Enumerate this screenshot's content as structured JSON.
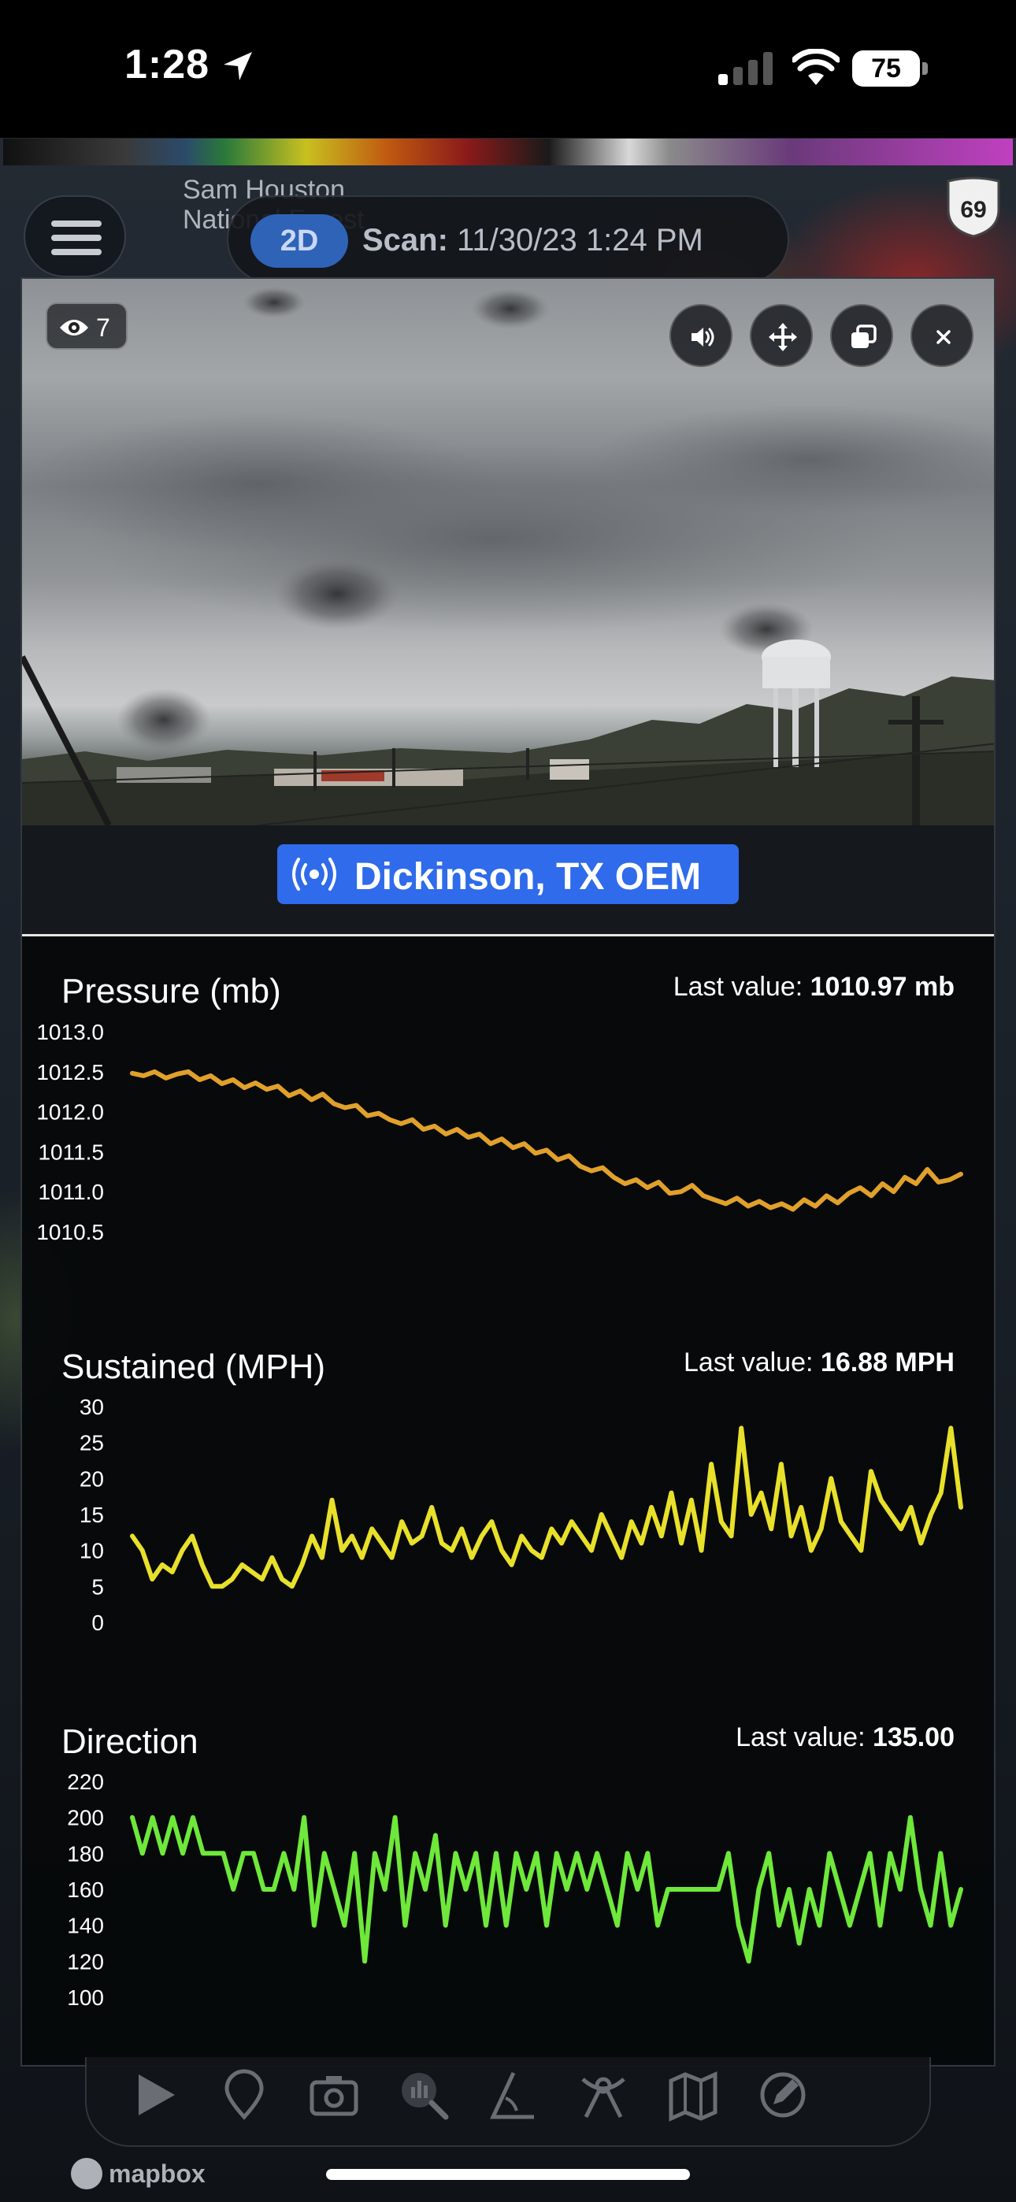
{
  "status_bar": {
    "time": "1:28",
    "battery": "75"
  },
  "map": {
    "label_line1": "Sam Houston",
    "label_line2": "National Forest",
    "route_number": "69"
  },
  "scan": {
    "mode": "2D",
    "label": "Scan:",
    "datetime": "11/30/23 1:24 PM"
  },
  "camera": {
    "viewer_count": "7"
  },
  "station": {
    "name": "Dickinson, TX OEM"
  },
  "charts": {
    "pressure": {
      "title": "Pressure (mb)",
      "last_label": "Last value:",
      "last_value": "1010.97 mb"
    },
    "sustained": {
      "title": "Sustained (MPH)",
      "last_label": "Last value:",
      "last_value": "16.88 MPH"
    },
    "direction": {
      "title": "Direction",
      "last_label": "Last value:",
      "last_value": "135.00"
    }
  },
  "chart_data": [
    {
      "type": "line",
      "title": "Pressure (mb)",
      "ylabel": "",
      "yticks": [
        "1013.0",
        "1012.5",
        "1012.0",
        "1011.5",
        "1011.0",
        "1010.5"
      ],
      "ylim": [
        1010.5,
        1013.0
      ],
      "color": "#e0a02a",
      "series": [
        {
          "values": [
            1012.48,
            1012.45,
            1012.5,
            1012.42,
            1012.47,
            1012.5,
            1012.4,
            1012.45,
            1012.35,
            1012.4,
            1012.3,
            1012.36,
            1012.28,
            1012.32,
            1012.2,
            1012.26,
            1012.15,
            1012.22,
            1012.1,
            1012.05,
            1012.08,
            1011.95,
            1011.98,
            1011.9,
            1011.85,
            1011.9,
            1011.78,
            1011.82,
            1011.72,
            1011.78,
            1011.68,
            1011.72,
            1011.6,
            1011.66,
            1011.55,
            1011.6,
            1011.48,
            1011.52,
            1011.4,
            1011.45,
            1011.32,
            1011.26,
            1011.3,
            1011.18,
            1011.1,
            1011.15,
            1011.05,
            1011.12,
            1010.98,
            1011.0,
            1011.08,
            1010.95,
            1010.9,
            1010.85,
            1010.92,
            1010.82,
            1010.88,
            1010.8,
            1010.85,
            1010.78,
            1010.9,
            1010.82,
            1010.95,
            1010.86,
            1010.98,
            1011.05,
            1010.95,
            1011.1,
            1011.0,
            1011.18,
            1011.1,
            1011.28,
            1011.12,
            1011.15,
            1011.22
          ]
        }
      ]
    },
    {
      "type": "line",
      "title": "Sustained (MPH)",
      "ylabel": "",
      "yticks": [
        "30",
        "25",
        "20",
        "15",
        "10",
        "5",
        "0"
      ],
      "ylim": [
        0,
        30
      ],
      "color": "#e8e02a",
      "series": [
        {
          "values": [
            12,
            10,
            6,
            8,
            7,
            10,
            12,
            8,
            5,
            5,
            6,
            8,
            7,
            6,
            9,
            6,
            5,
            8,
            12,
            9,
            17,
            10,
            12,
            9,
            13,
            11,
            9,
            14,
            11,
            12,
            16,
            11,
            10,
            13,
            9,
            12,
            14,
            10,
            8,
            12,
            10,
            9,
            13,
            11,
            14,
            12,
            10,
            15,
            12,
            9,
            14,
            11,
            16,
            12,
            18,
            11,
            17,
            10,
            22,
            14,
            12,
            27,
            15,
            18,
            13,
            22,
            12,
            16,
            10,
            13,
            20,
            14,
            12,
            10,
            21,
            17,
            15,
            13,
            16,
            11,
            15,
            18,
            27,
            16
          ]
        }
      ]
    },
    {
      "type": "line",
      "title": "Direction",
      "ylabel": "",
      "yticks": [
        "220",
        "200",
        "180",
        "160",
        "140",
        "120",
        "100"
      ],
      "ylim": [
        100,
        220
      ],
      "color": "#6ee83a",
      "series": [
        {
          "values": [
            200,
            180,
            200,
            180,
            200,
            180,
            200,
            180,
            180,
            180,
            160,
            180,
            180,
            160,
            160,
            180,
            160,
            200,
            140,
            180,
            160,
            140,
            180,
            120,
            180,
            160,
            200,
            140,
            180,
            160,
            190,
            140,
            180,
            160,
            180,
            140,
            180,
            140,
            180,
            160,
            180,
            140,
            180,
            160,
            180,
            160,
            180,
            160,
            140,
            180,
            160,
            180,
            140,
            160,
            160,
            160,
            160,
            160,
            160,
            180,
            140,
            120,
            160,
            180,
            140,
            160,
            130,
            160,
            140,
            180,
            160,
            140,
            160,
            180,
            140,
            180,
            160,
            200,
            160,
            140,
            180,
            140,
            160
          ]
        }
      ]
    }
  ],
  "toolbar": {
    "icons": [
      "play-icon",
      "location-pin-icon",
      "camera-icon",
      "chart-search-icon",
      "measure-icon",
      "satellite-icon",
      "map-icon",
      "edit-icon"
    ]
  },
  "mapbox": {
    "text": "mapbox"
  }
}
